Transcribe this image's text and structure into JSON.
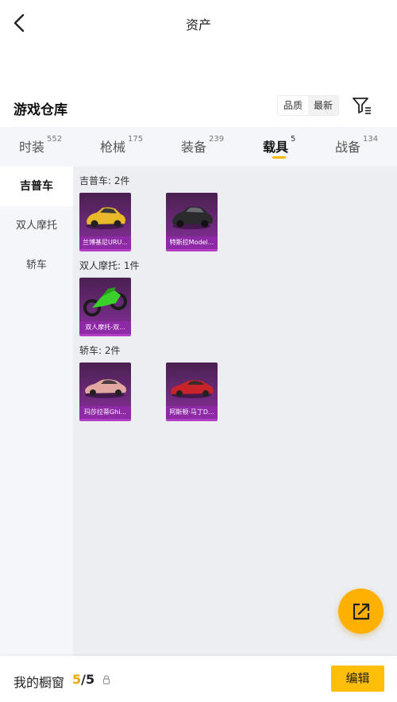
{
  "header": {
    "title": "资产"
  },
  "warehouse": {
    "title": "游戏仓库",
    "sort_options": [
      "品质",
      "最新"
    ]
  },
  "tabs": [
    {
      "label": "时装",
      "count": "552"
    },
    {
      "label": "枪械",
      "count": "175"
    },
    {
      "label": "装备",
      "count": "239"
    },
    {
      "label": "载具",
      "count": "5"
    },
    {
      "label": "战备",
      "count": "134"
    }
  ],
  "active_tab": "载具",
  "sidebar": {
    "items": [
      "吉普车",
      "双人摩托",
      "轿车"
    ],
    "active": "吉普车"
  },
  "groups": [
    {
      "label": "吉普车: 2件",
      "items": [
        {
          "name": "兰博基尼URU...",
          "icon": "yellow-suv-car"
        },
        {
          "name": "特斯拉Model...",
          "icon": "black-suv-car"
        }
      ]
    },
    {
      "label": "双人摩托: 1件",
      "items": [
        {
          "name": "双人摩托-双...",
          "icon": "green-motorcycle"
        }
      ]
    },
    {
      "label": "轿车: 2件",
      "items": [
        {
          "name": "玛莎拉蒂Ghi...",
          "icon": "pink-sedan-car"
        },
        {
          "name": "阿斯顿·马丁D...",
          "icon": "red-sports-car"
        }
      ]
    }
  ],
  "bottom": {
    "label": "我的橱窗",
    "current": "5",
    "sep_total": "/5",
    "edit_label": "编辑"
  },
  "colors": {
    "accent": "#ffb000",
    "card_purple": "#8e2aa6"
  }
}
